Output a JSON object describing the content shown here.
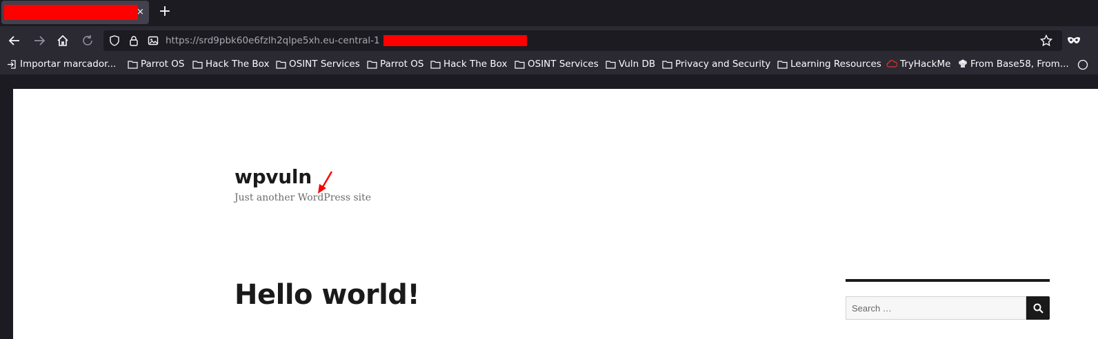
{
  "browser": {
    "new_tab_label": "+",
    "close_tab_label": "×",
    "url": "https://srd9pbk60e6fzlh2qlpe5xh.eu-central-1",
    "bookmarks": [
      {
        "label": "Importar marcador...",
        "icon": "import-icon"
      },
      {
        "label": "Parrot OS",
        "icon": "folder-icon"
      },
      {
        "label": "Hack The Box",
        "icon": "folder-icon"
      },
      {
        "label": "OSINT Services",
        "icon": "folder-icon"
      },
      {
        "label": "Parrot OS",
        "icon": "folder-icon"
      },
      {
        "label": "Hack The Box",
        "icon": "folder-icon"
      },
      {
        "label": "OSINT Services",
        "icon": "folder-icon"
      },
      {
        "label": "Vuln DB",
        "icon": "folder-icon"
      },
      {
        "label": "Privacy and Security",
        "icon": "folder-icon"
      },
      {
        "label": "Learning Resources",
        "icon": "folder-icon"
      },
      {
        "label": "TryHackMe",
        "icon": "cloud-icon"
      },
      {
        "label": "From Base58, From...",
        "icon": "chef-icon"
      }
    ]
  },
  "page": {
    "site_title": "wpvuln",
    "site_description": "Just another WordPress site",
    "post_title": "Hello world!",
    "search_placeholder": "Search …"
  },
  "colors": {
    "redaction": "#ff0000",
    "annotation_arrow": "#ff0000",
    "toolbar": "#2b2a33",
    "tabstrip": "#1c1b22"
  }
}
